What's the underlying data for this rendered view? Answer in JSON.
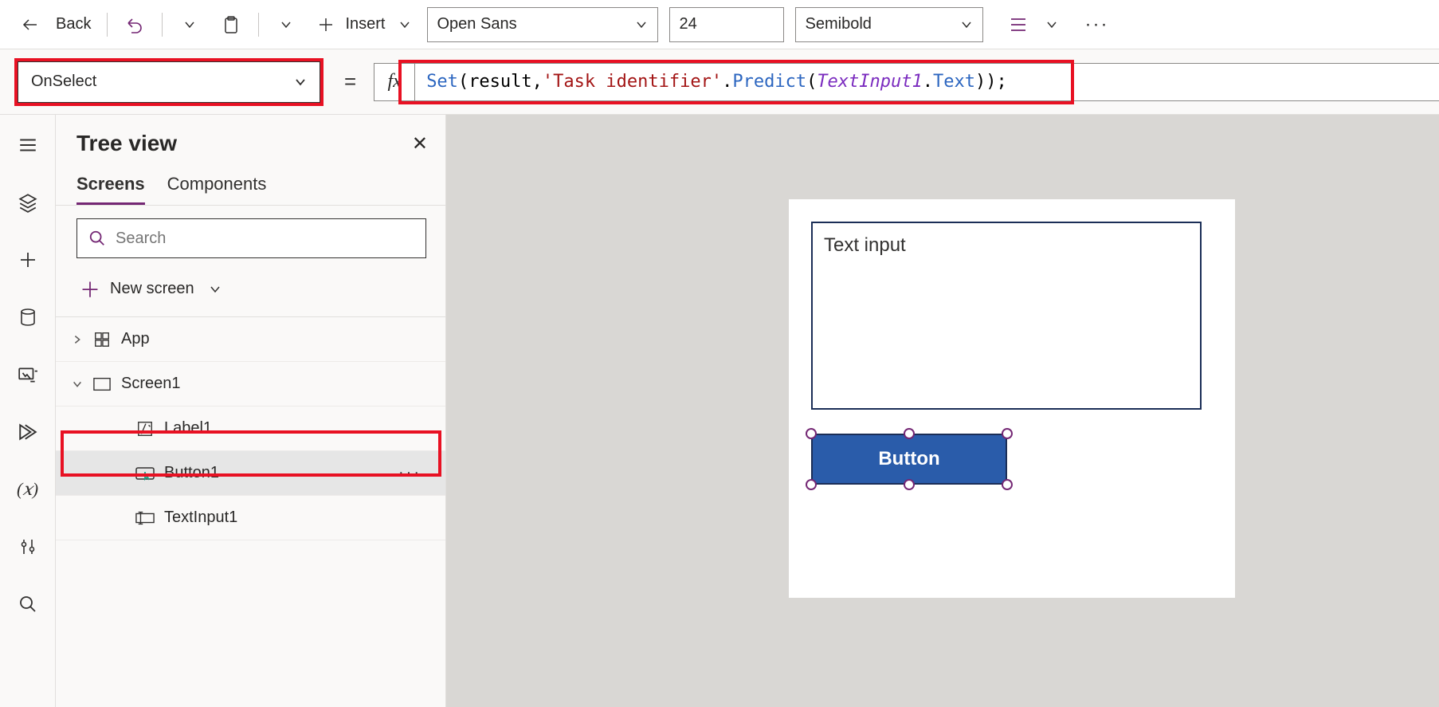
{
  "toolbar": {
    "back_label": "Back",
    "insert_label": "Insert",
    "font_family": "Open Sans",
    "font_size": "24",
    "font_weight": "Semibold"
  },
  "formula": {
    "property": "OnSelect",
    "tokens": {
      "set": "Set",
      "lp1": "(",
      "result": "result",
      "comma": ", ",
      "str": "'Task identifier'",
      "dot1": ".",
      "predict": "Predict",
      "lp2": "(",
      "obj": "TextInput1",
      "dot2": ".",
      "text": "Text",
      "rp": "));"
    }
  },
  "tree": {
    "title": "Tree view",
    "tabs": {
      "screens": "Screens",
      "components": "Components"
    },
    "search_placeholder": "Search",
    "new_screen": "New screen",
    "items": {
      "app": "App",
      "screen1": "Screen1",
      "label1": "Label1",
      "button1": "Button1",
      "textinput1": "TextInput1"
    }
  },
  "canvas": {
    "textinput_value": "Text input",
    "button_label": "Button"
  }
}
